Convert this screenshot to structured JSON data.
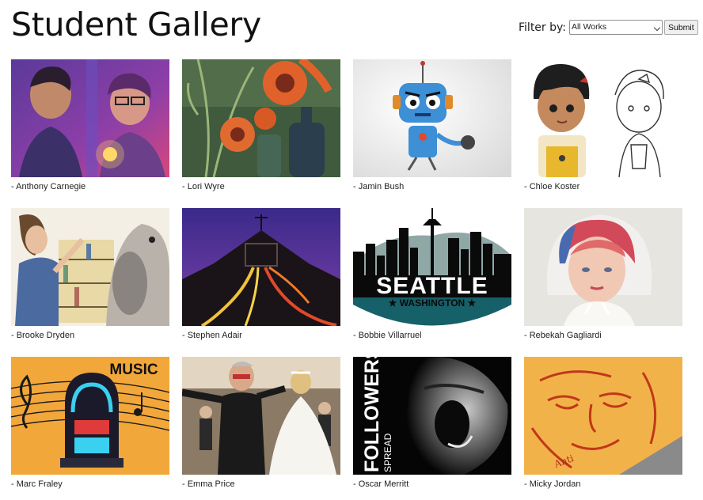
{
  "header": {
    "title": "Student Gallery"
  },
  "filter": {
    "label": "Filter by:",
    "selected": "All Works",
    "submit_label": "Submit"
  },
  "gallery": {
    "items": [
      {
        "caption": "- Anthony Carnegie",
        "art": "two-portraits-neon"
      },
      {
        "caption": "- Lori Wyre",
        "art": "poppies-and-bottles"
      },
      {
        "caption": "- Jamin Bush",
        "art": "blue-robot"
      },
      {
        "caption": "- Chloe Koster",
        "art": "cartoon-girl-sketches"
      },
      {
        "caption": "- Brooke Dryden",
        "art": "girl-and-rabbit"
      },
      {
        "caption": "- Stephen Adair",
        "art": "light-trails-hoop"
      },
      {
        "caption": "- Bobbie Villarruel",
        "art": "seattle-washington-logo"
      },
      {
        "caption": "- Rebekah Gagliardi",
        "art": "colorful-hair-portrait"
      },
      {
        "caption": "- Marc Fraley",
        "art": "music-jukebox"
      },
      {
        "caption": "- Emma Price",
        "art": "wedding-dance"
      },
      {
        "caption": "- Oscar Merritt",
        "art": "followers-spread"
      },
      {
        "caption": "- Micky Jordan",
        "art": "orange-face-print"
      }
    ]
  },
  "artwork_text": {
    "seattle": "SEATTLE",
    "washington": "★ WASHINGTON ★",
    "music": "MUSIC",
    "followers": "FOLLOWERS",
    "spread": "SPREAD"
  }
}
